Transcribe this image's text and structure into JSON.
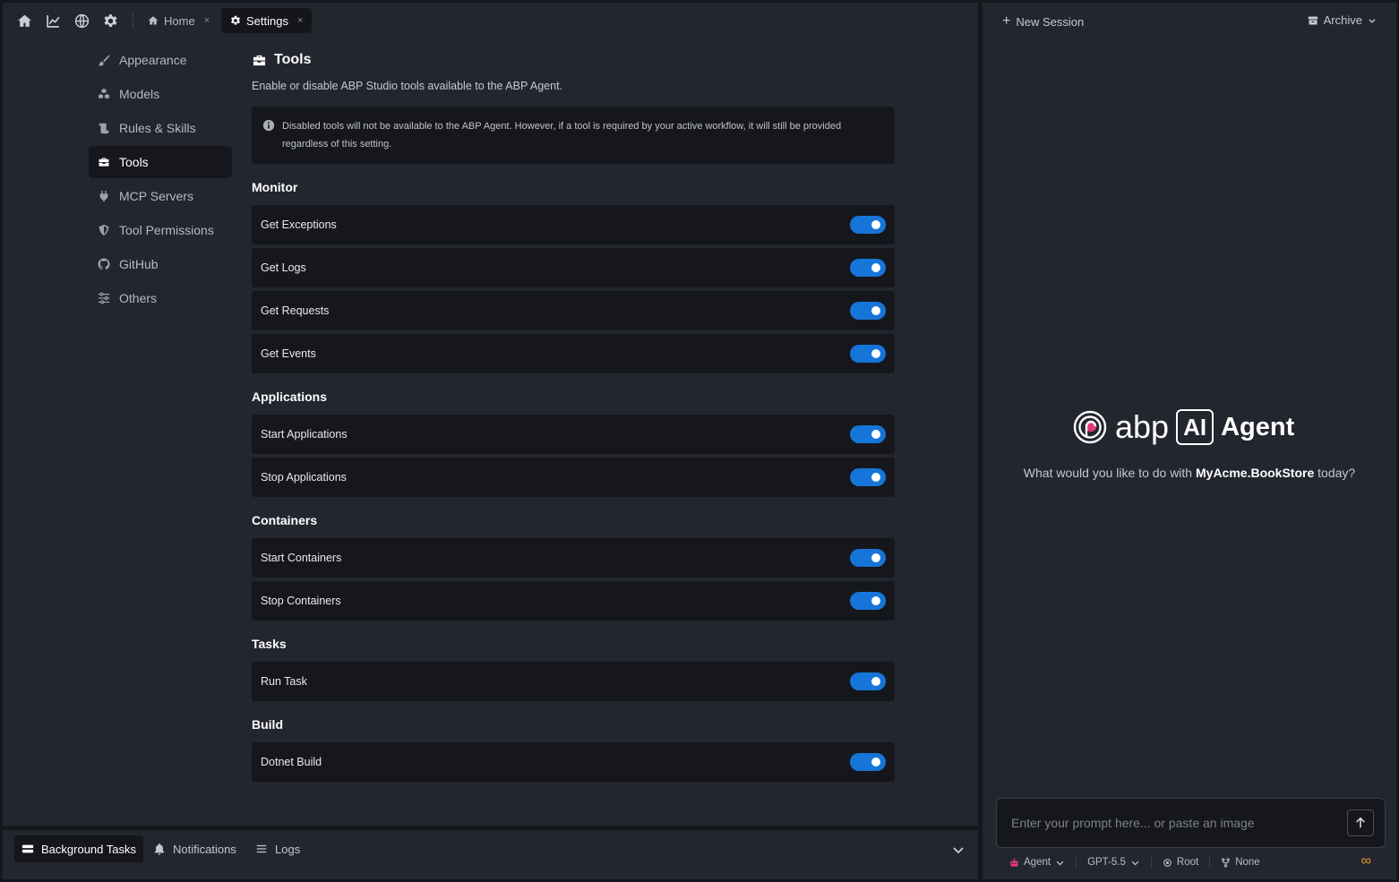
{
  "topbar": {
    "icons": [
      "home-icon",
      "chart-icon",
      "globe-icon",
      "gear-icon"
    ],
    "tabs": [
      {
        "label": "Home",
        "icon": "home-icon",
        "active": false
      },
      {
        "label": "Settings",
        "icon": "gear-icon",
        "active": true
      }
    ],
    "close_glyph": "×"
  },
  "sidebar": {
    "items": [
      {
        "label": "Appearance",
        "icon": "brush-icon"
      },
      {
        "label": "Models",
        "icon": "cubes-icon"
      },
      {
        "label": "Rules & Skills",
        "icon": "scroll-icon"
      },
      {
        "label": "Tools",
        "icon": "toolbox-icon",
        "active": true
      },
      {
        "label": "MCP Servers",
        "icon": "plug-icon"
      },
      {
        "label": "Tool Permissions",
        "icon": "shield-icon"
      },
      {
        "label": "GitHub",
        "icon": "github-icon"
      },
      {
        "label": "Others",
        "icon": "sliders-icon"
      }
    ]
  },
  "main": {
    "title": "Tools",
    "subtitle": "Enable or disable ABP Studio tools available to the ABP Agent.",
    "info": "Disabled tools will not be available to the ABP Agent. However, if a tool is required by your active workflow, it will still be provided regardless of this setting.",
    "sections": [
      {
        "name": "Monitor",
        "tools": [
          {
            "label": "Get Exceptions",
            "enabled": true
          },
          {
            "label": "Get Logs",
            "enabled": true
          },
          {
            "label": "Get Requests",
            "enabled": true
          },
          {
            "label": "Get Events",
            "enabled": true
          }
        ]
      },
      {
        "name": "Applications",
        "tools": [
          {
            "label": "Start Applications",
            "enabled": true
          },
          {
            "label": "Stop Applications",
            "enabled": true
          }
        ]
      },
      {
        "name": "Containers",
        "tools": [
          {
            "label": "Start Containers",
            "enabled": true
          },
          {
            "label": "Stop Containers",
            "enabled": true
          }
        ]
      },
      {
        "name": "Tasks",
        "tools": [
          {
            "label": "Run Task",
            "enabled": true
          }
        ]
      },
      {
        "name": "Build",
        "tools": [
          {
            "label": "Dotnet Build",
            "enabled": true
          }
        ]
      }
    ],
    "toggle_color": "#1675d8"
  },
  "bottombar": {
    "tabs": [
      {
        "label": "Background Tasks",
        "icon": "tasks-icon",
        "active": true
      },
      {
        "label": "Notifications",
        "icon": "bell-icon",
        "active": false
      },
      {
        "label": "Logs",
        "icon": "list-icon",
        "active": false
      }
    ]
  },
  "agent_panel": {
    "new_session": "New Session",
    "archive": "Archive",
    "logo": {
      "abp": "abp",
      "ai": "AI",
      "agent": "Agent"
    },
    "question_prefix": "What would you like to do with ",
    "project": "MyAcme.BookStore",
    "question_suffix": " today?",
    "prompt_placeholder": "Enter your prompt here... or paste an image",
    "footer": {
      "mode": "Agent",
      "model": "GPT-5.5",
      "scope": "Root",
      "branch": "None",
      "infinity": "∞"
    },
    "accent": "#e79a23"
  }
}
